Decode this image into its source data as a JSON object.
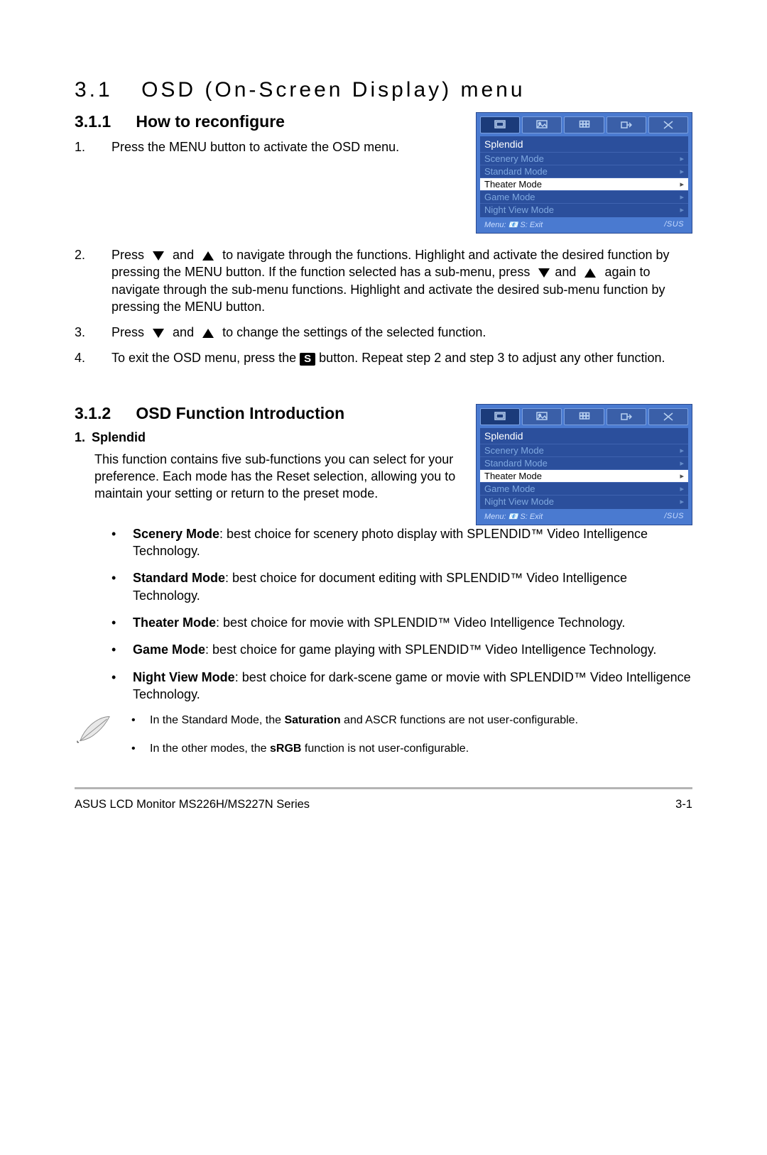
{
  "headings": {
    "h1_num": "3.1",
    "h1_text": "OSD (On-Screen Display) menu",
    "h2a_num": "3.1.1",
    "h2a_text": "How to reconfigure",
    "h2b_num": "3.1.2",
    "h2b_text": "OSD Function Introduction",
    "h3_num": "1.",
    "h3_text": "Splendid"
  },
  "steps": {
    "s1": "Press the MENU button to activate the OSD menu.",
    "s2a": "Press",
    "s2b": "and",
    "s2c": "to navigate through the functions. Highlight and activate the desired function by pressing the MENU button. If the function selected has a sub-menu, press",
    "s2d": "and",
    "s2e": "again to navigate through the sub-menu functions. Highlight and activate the desired sub-menu function by pressing the MENU button.",
    "s3a": "Press",
    "s3b": "and",
    "s3c": "to change the settings of the selected function.",
    "s4a": "To exit the OSD menu, press the",
    "s4b": "button. Repeat step 2 and step 3 to adjust any other function.",
    "s_button": "S"
  },
  "splendid_para": "This function contains five sub-functions you can select for your preference. Each mode has the Reset selection, allowing you to maintain your setting or return to the preset mode.",
  "modes": {
    "scenery_b": "Scenery Mode",
    "scenery_t": ": best choice for scenery photo display with SPLENDID™ Video Intelligence Technology.",
    "standard_b": "Standard Mode",
    "standard_t": ": best choice for document editing with SPLENDID™ Video Intelligence Technology.",
    "theater_b": "Theater Mode",
    "theater_t": ": best choice for movie with SPLENDID™ Video Intelligence Technology.",
    "game_b": "Game Mode",
    "game_t": ": best choice for game playing with SPLENDID™ Video Intelligence Technology.",
    "night_b": "Night View Mode",
    "night_t": ": best choice for dark-scene game or movie with SPLENDID™ Video Intelligence Technology."
  },
  "notes": {
    "n1a": "In the Standard Mode, the ",
    "n1b": "Saturation",
    "n1c": " and ASCR functions are not user-configurable.",
    "n2a": "In the other modes, the ",
    "n2b": "sRGB",
    "n2c": " function is not user-configurable."
  },
  "osd": {
    "title": "Splendid",
    "items": [
      "Scenery Mode",
      "Standard Mode",
      "Theater Mode",
      "Game Mode",
      "Night View Mode"
    ],
    "selected_index": 2,
    "footer_left": "Menu: 📧   S: Exit",
    "brand": "/SUS"
  },
  "footer": {
    "left": "ASUS LCD Monitor MS226H/MS227N Series",
    "right": "3-1"
  }
}
